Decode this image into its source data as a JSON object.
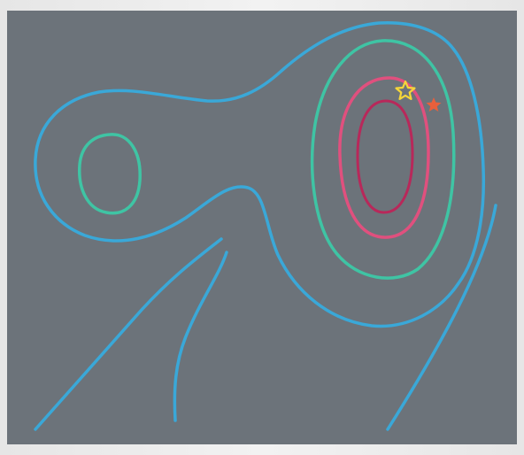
{
  "colors": {
    "background_panel": "#6c737a",
    "outer_contour": "#3aa8d8",
    "second_contour": "#3fc4a4",
    "third_contour": "#e0507e",
    "inner_contour": "#b8285a",
    "outline_star": "#f5d63a",
    "filled_star": "#e8603c"
  },
  "markers": [
    {
      "name": "outline-star-icon",
      "style": "outline"
    },
    {
      "name": "filled-star-icon",
      "style": "filled"
    }
  ]
}
